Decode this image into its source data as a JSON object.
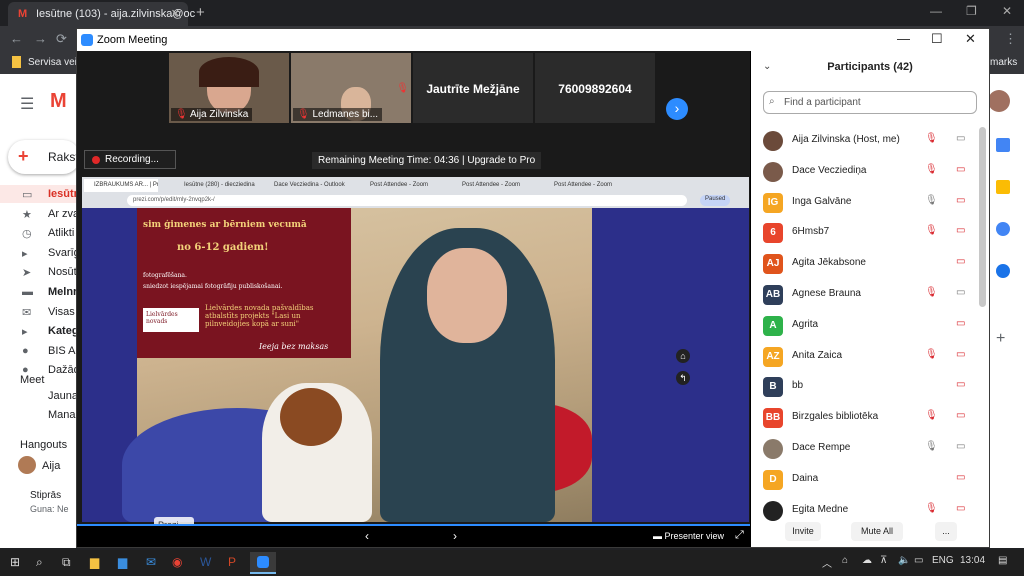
{
  "chrome": {
    "tab_title": "Iesūtne (103) - aija.zilvinska@oc",
    "gmail_letter": "M",
    "bookmark": "Servisa veik",
    "bookmark_right": "marks"
  },
  "gmail": {
    "compose": "Rakst",
    "items": [
      "Iesūtn",
      "Ar zva",
      "Atlikti",
      "Svarīg",
      "Nosūt",
      "Melnr",
      "Visas",
      "Kateg",
      "BIS A",
      "Dažād"
    ],
    "meet_label": "Meet",
    "meet_items": [
      "Jauna",
      "Mana"
    ],
    "hangouts_label": "Hangouts",
    "hangouts_user": "Aija",
    "hangouts_chat": "Stiprās",
    "hangouts_sub": "Guna: Ne"
  },
  "zoom": {
    "window_title": "Zoom Meeting",
    "thumbs": [
      {
        "name": "Aija Zilvinska",
        "video": true
      },
      {
        "name": "Ledmanes bi...",
        "video": true
      },
      {
        "name": "Jautrīte Mežjāne",
        "video": false
      },
      {
        "name": "76009892604",
        "video": false
      }
    ],
    "recording": "Recording...",
    "remaining": "Remaining Meeting Time: 04:36 | Upgrade to Pro",
    "inner_tabs": [
      "IZBRAUKUMS AR... | Prezi",
      "Iesūtne (280) - diecziedina",
      "Dace Vecziedina - Outlook",
      "Post Attendee - Zoom",
      "Post Attendee - Zoom",
      "Post Attendee - Zoom"
    ],
    "inner_url": "prezi.com/p/edit/mly-2nvqp2k-/",
    "inner_paused": "Paused",
    "poster": {
      "line1": "sim ģimenes ar bērniem vecumā",
      "line2": "no 6-12 gadiem!",
      "line3": "fotografēšana.",
      "line4": "sniedzot iespējamai fotogrāfiju publiskošanai.",
      "logo": "Lielvārdes novads",
      "line5": "Lielvārdes novada pašvaldības atbalstīts projekts \"Lasi un pilnveidojies kopā ar suni\"",
      "line6": "Ieeja bez maksas"
    },
    "prezi_label": "Prezi",
    "presenter_view": "Presenter view"
  },
  "participants": {
    "title": "Participants (42)",
    "search_placeholder": "Find a participant",
    "list": [
      {
        "name": "Aija Zilvinska (Host, me)",
        "initials": "",
        "color": "#6b4a3a",
        "photo": true
      },
      {
        "name": "Dace Vecziediņa",
        "initials": "",
        "color": "#7a5a4a",
        "photo": true
      },
      {
        "name": "Inga Galvāne",
        "initials": "IG",
        "color": "#f5a623"
      },
      {
        "name": "6Hmsb7",
        "initials": "6",
        "color": "#e8452c"
      },
      {
        "name": "Agita Jēkabsone",
        "initials": "AJ",
        "color": "#e0541c"
      },
      {
        "name": "Agnese Brauna",
        "initials": "AB",
        "color": "#2f3f5a"
      },
      {
        "name": "Agrita",
        "initials": "A",
        "color": "#2eb24a"
      },
      {
        "name": "Anita Zaica",
        "initials": "AZ",
        "color": "#f5a623"
      },
      {
        "name": "bb",
        "initials": "B",
        "color": "#2f3f5a"
      },
      {
        "name": "Birzgales bibliotēka",
        "initials": "BB",
        "color": "#e8452c"
      },
      {
        "name": "Dace Rempe",
        "initials": "",
        "color": "#8a7a6a",
        "photo": true
      },
      {
        "name": "Daina",
        "initials": "D",
        "color": "#f5a623"
      },
      {
        "name": "Egita Medne",
        "initials": "",
        "color": "#222",
        "photo": true
      }
    ],
    "invite": "Invite",
    "mute_all": "Mute All",
    "more": "..."
  },
  "taskbar": {
    "lang": "ENG",
    "time": "13:04"
  }
}
